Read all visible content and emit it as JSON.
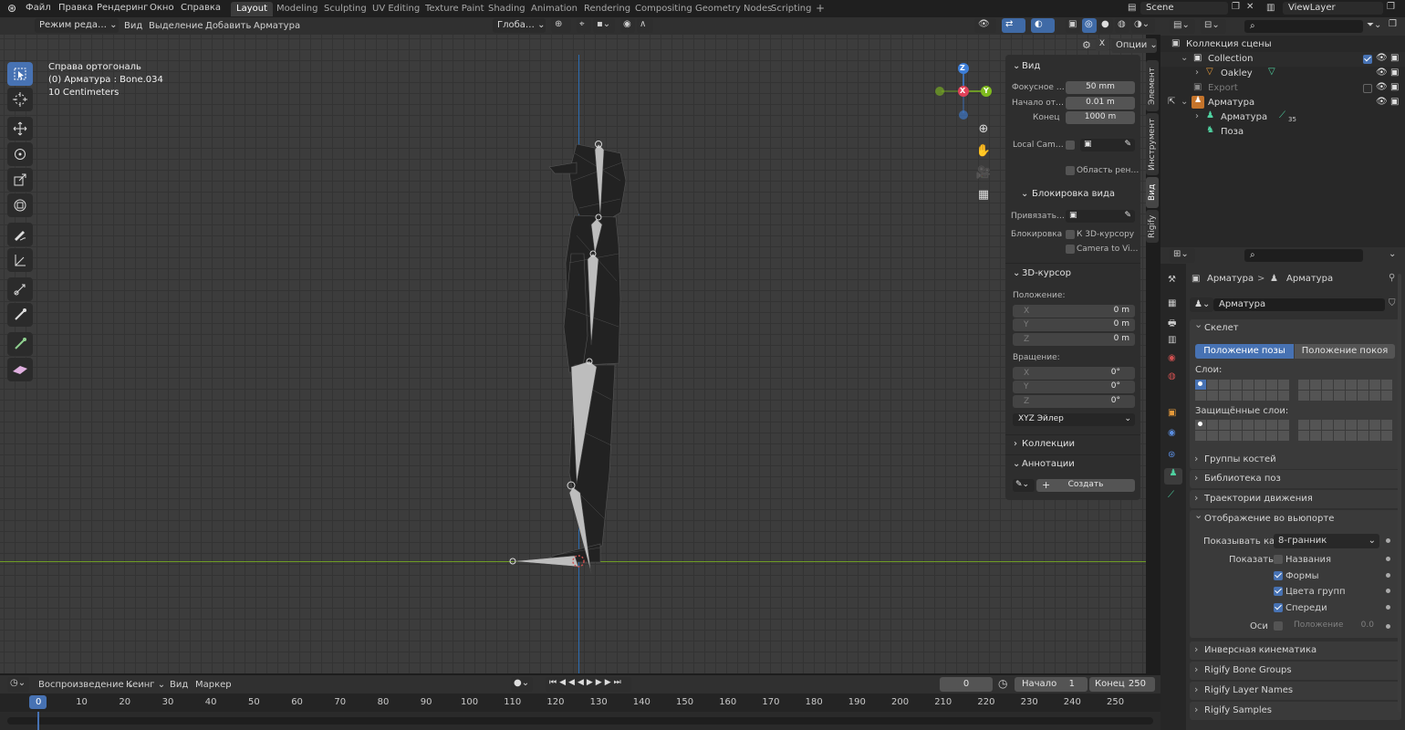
{
  "menubar": {
    "items": [
      "Файл",
      "Правка",
      "Рендеринг",
      "Окно",
      "Справка"
    ],
    "workspaces": [
      "Layout",
      "Modeling",
      "Sculpting",
      "UV Editing",
      "Texture Paint",
      "Shading",
      "Animation",
      "Rendering",
      "Compositing",
      "Geometry Nodes",
      "Scripting"
    ],
    "add_tab": "+",
    "scene": "Scene",
    "view_layer": "ViewLayer"
  },
  "viewport_header": {
    "mode": "Режим реда…",
    "menus": [
      "Вид",
      "Выделение",
      "Добавить",
      "Арматура"
    ],
    "transform": "Глоба…",
    "options": "Опции"
  },
  "viewport_overlay": {
    "view_name": "Справа ортогональ",
    "object": "(0) Арматура : Bone.034",
    "scale": "10 Centimeters"
  },
  "gizmo": {
    "z": "Z",
    "x": "X",
    "y": "Y"
  },
  "tools": [
    "select-box-icon",
    "cursor-icon",
    "move-icon",
    "rotate-icon",
    "scale-icon",
    "transform-icon",
    "annotate-icon",
    "measure-icon",
    "roll-icon",
    "bone-size-icon",
    "extrude-icon",
    "bone-envelope-icon"
  ],
  "npanel": {
    "view_title": "Вид",
    "focal_label": "Фокусное …",
    "focal_value": "50 mm",
    "clip_start_label": "Начало от…",
    "clip_start_value": "0.01 m",
    "clip_end_label": "Конец",
    "clip_end_value": "1000 m",
    "local_camera_label": "Local Cam…",
    "render_region_label": "Область рен…",
    "view_lock_title": "Блокировка вида",
    "lock_to_label": "Привязать…",
    "lock_label": "Блокировка",
    "lock_cursor_label": "К 3D-курсору",
    "camera_to_view_label": "Camera to Vi…",
    "cursor_title": "3D-курсор",
    "location_label": "Положение:",
    "loc": [
      {
        "axis": "X",
        "value": "0 m"
      },
      {
        "axis": "Y",
        "value": "0 m"
      },
      {
        "axis": "Z",
        "value": "0 m"
      }
    ],
    "rotation_label": "Вращение:",
    "rot": [
      {
        "axis": "X",
        "value": "0°"
      },
      {
        "axis": "Y",
        "value": "0°"
      },
      {
        "axis": "Z",
        "value": "0°"
      }
    ],
    "rotation_mode": "XYZ Эйлер",
    "collections_title": "Коллекции",
    "annotations_title": "Аннотации",
    "create_label": "Создать",
    "plus": "+"
  },
  "side_tabs": [
    "Элемент",
    "Инструмент",
    "Вид",
    "Rigify"
  ],
  "outliner": {
    "root": "Коллекция сцены",
    "rows": [
      {
        "name": "Collection",
        "color": "#d8d8d8"
      },
      {
        "name": "Oakley",
        "color": "#d8d8d8"
      },
      {
        "name": "Export",
        "color": "#7a7a7a"
      },
      {
        "name": "Арматура",
        "color": "#d8d8d8"
      },
      {
        "name": "Арматура",
        "color": "#d8d8d8"
      },
      {
        "name": "Поза",
        "color": "#d8d8d8"
      }
    ],
    "bone_count": "35"
  },
  "properties": {
    "breadcrumb_1": "Арматура",
    "breadcrumb_sep": ">",
    "breadcrumb_2": "Арматура",
    "name_value": "Арматура",
    "skeleton_title": "Скелет",
    "pose_position": "Положение позы",
    "rest_position": "Положение покоя",
    "layers_label": "Слои:",
    "protected_layers_label": "Защищённые слои:",
    "bone_groups": "Группы костей",
    "pose_library": "Библиотека поз",
    "motion_paths": "Траектории движения",
    "viewport_display": "Отображение во вьюпорте",
    "display_as_label": "Показывать как",
    "display_as_value": "8-гранник",
    "show_label": "Показать",
    "names_label": "Названия",
    "shapes_label": "Формы",
    "group_colors_label": "Цвета групп",
    "in_front_label": "Спереди",
    "axes_label": "Оси",
    "axes_position_label": "Положение",
    "axes_position_value": "0.0",
    "ik": "Инверсная кинематика",
    "rigify_bone_groups": "Rigify Bone Groups",
    "rigify_layer_names": "Rigify Layer Names",
    "rigify_samples": "Rigify Samples"
  },
  "timeline": {
    "playback": "Воспроизведение",
    "keying": "Кеинг",
    "view": "Вид",
    "marker": "Маркер",
    "current_frame": "0",
    "start_label": "Начало",
    "start_value": "1",
    "end_label": "Конец",
    "end_value": "250",
    "frames": [
      "0",
      "10",
      "20",
      "30",
      "40",
      "50",
      "60",
      "70",
      "80",
      "90",
      "100",
      "110",
      "120",
      "130",
      "140",
      "150",
      "160",
      "170",
      "180",
      "190",
      "200",
      "210",
      "220",
      "230",
      "240",
      "250"
    ]
  },
  "colors": {
    "accent": "#4772b3",
    "x_axis": "#e2425a",
    "y_axis": "#7fba1e",
    "z_axis": "#3d7ed8"
  }
}
